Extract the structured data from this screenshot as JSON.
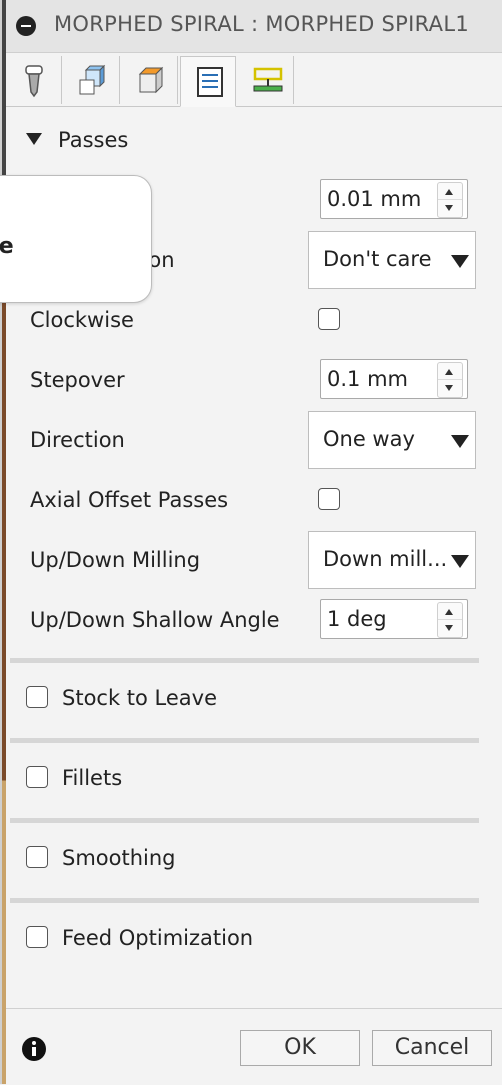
{
  "window": {
    "title": "MORPHED SPIRAL : MORPHED SPIRAL1"
  },
  "tabs": [
    {
      "icon": "tool-icon"
    },
    {
      "icon": "geometry-icon"
    },
    {
      "icon": "heights-icon"
    },
    {
      "icon": "passes-icon",
      "active": true
    },
    {
      "icon": "linking-icon"
    }
  ],
  "passes": {
    "header": "Passes",
    "tolerance": {
      "value": "0.01 mm"
    },
    "sideways_direction": {
      "label_visible": "side Direction",
      "value": "Don't care"
    },
    "clockwise": {
      "label": "Clockwise",
      "checked": false
    },
    "stepover": {
      "label": "Stepover",
      "value": "0.1 mm"
    },
    "direction": {
      "label": "Direction",
      "value": "One way"
    },
    "axial_offset": {
      "label": "Axial Offset Passes",
      "checked": false
    },
    "updown_milling": {
      "label": "Up/Down Milling",
      "value": "Down mill..."
    },
    "updown_angle": {
      "label": "Up/Down Shallow Angle",
      "value": "1 deg"
    }
  },
  "groups": [
    {
      "label": "Stock to Leave",
      "checked": false
    },
    {
      "label": "Fillets",
      "checked": false
    },
    {
      "label": "Smoothing",
      "checked": false
    },
    {
      "label": "Feed Optimization",
      "checked": false
    }
  ],
  "tooltip": {
    "text": "pe"
  },
  "footer": {
    "ok": "OK",
    "cancel": "Cancel"
  }
}
